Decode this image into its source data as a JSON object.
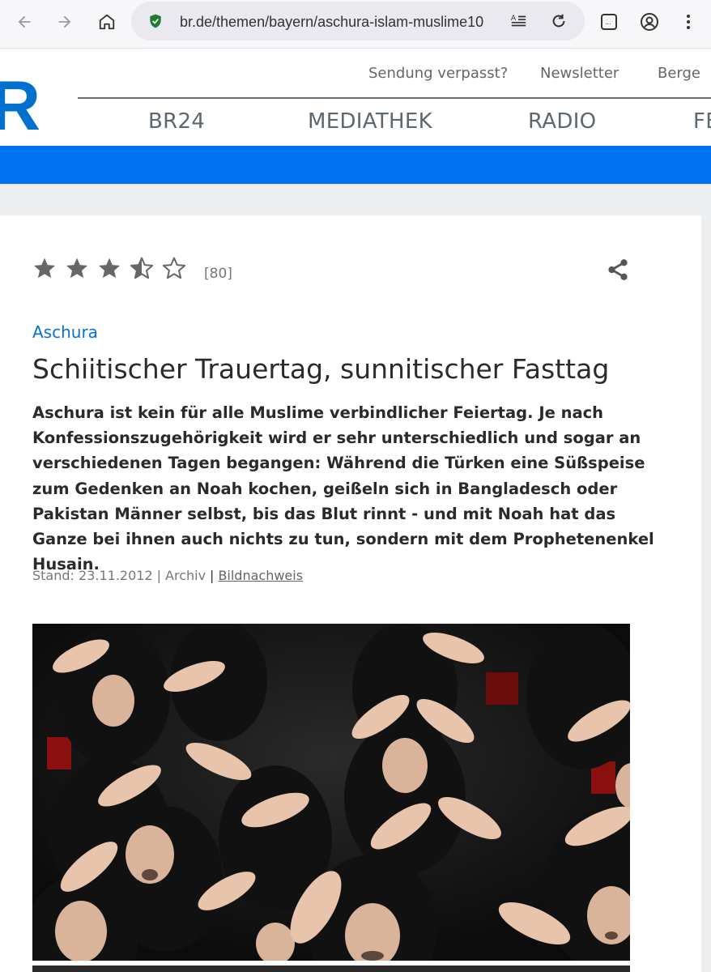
{
  "browser": {
    "url": "br.de/themen/bayern/aschura-islam-muslime10",
    "icons": {
      "back": "arrow-left-icon",
      "forward": "arrow-right-icon",
      "home": "home-icon",
      "secure": "shield-check-icon",
      "reader": "reader-mode-icon",
      "reload": "reload-icon",
      "tabs": "tabs-icon",
      "account": "account-icon",
      "menu": "more-vert-icon"
    }
  },
  "site": {
    "logo_letter": "R",
    "top_links": [
      "Sendung verpasst?",
      "Newsletter",
      "Berge"
    ],
    "main_nav": [
      "BR24",
      "MEDIATHEK",
      "RADIO",
      "FE"
    ],
    "brand_color": "#0072f0"
  },
  "article": {
    "rating": {
      "stars": 3.5,
      "max": 5,
      "count_label": "[80]"
    },
    "kicker": "Aschura",
    "headline": "Schiitischer Trauertag, sunnitischer Fasttag",
    "teaser": "Aschura ist kein für alle Muslime verbindlicher Feiertag. Je nach Konfessionszugehörigkeit wird er sehr unterschiedlich und sogar an verschiedenen Tagen begangen: Während die Türken eine Süßspeise zum Gedenken an Noah kochen, geißeln sich in Bangladesch oder Pakistan Männer selbst, bis das Blut rinnt - und mit Noah hat das Ganze bei ihnen auch nichts zu tun, sondern mit dem Prophetenenkel Husain.",
    "meta": {
      "stand": "Stand: 23.11.2012",
      "archive": "Archiv",
      "credits": "Bildnachweis"
    },
    "image_alt": "Crowd of women in black headscarves with hands on their heads"
  }
}
